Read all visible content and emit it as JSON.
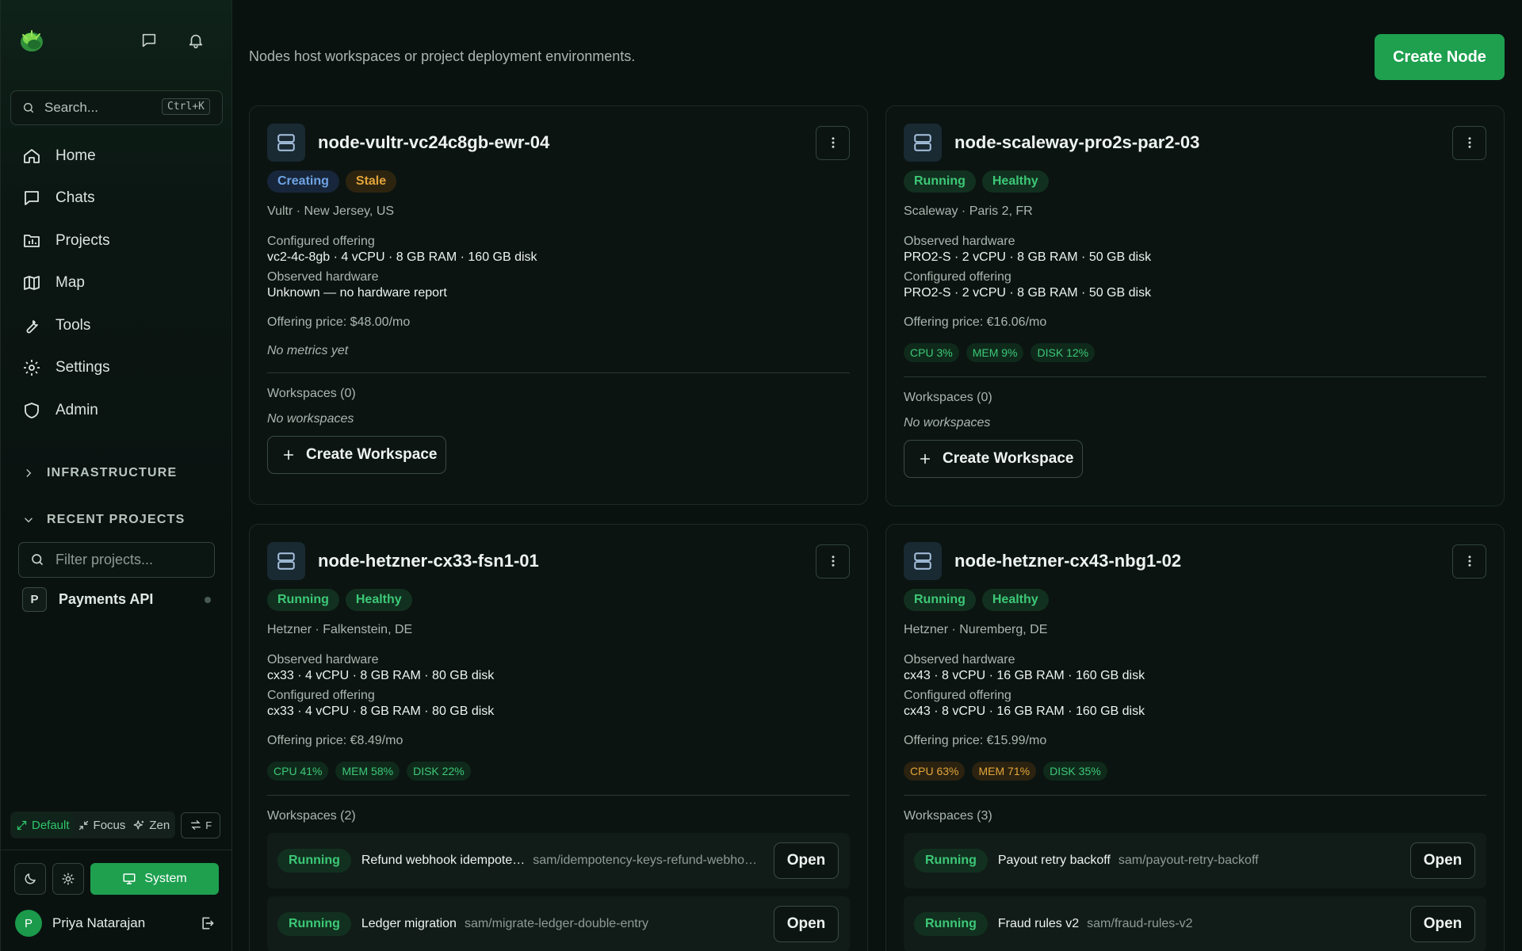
{
  "sidebar": {
    "search": {
      "label": "Search...",
      "shortcut": "Ctrl+K"
    },
    "nav": [
      {
        "label": "Home",
        "icon": "home-icon"
      },
      {
        "label": "Chats",
        "icon": "chat-icon"
      },
      {
        "label": "Projects",
        "icon": "projects-icon"
      },
      {
        "label": "Map",
        "icon": "map-icon"
      },
      {
        "label": "Tools",
        "icon": "wrench-icon"
      },
      {
        "label": "Settings",
        "icon": "gear-icon"
      },
      {
        "label": "Admin",
        "icon": "shield-icon"
      }
    ],
    "infrastructure_label": "INFRASTRUCTURE",
    "recent_projects_label": "RECENT PROJECTS",
    "filter_placeholder": "Filter projects...",
    "projects": [
      {
        "initial": "P",
        "name": "Payments API"
      }
    ],
    "modes": {
      "default": "Default",
      "focus": "Focus",
      "zen": "Zen",
      "swap_key": "F"
    },
    "theme": {
      "system_label": "System"
    },
    "user": {
      "initial": "P",
      "name": "Priya Natarajan"
    }
  },
  "header": {
    "subtitle": "Nodes host workspaces or project deployment environments.",
    "create_node_label": "Create Node"
  },
  "colors": {
    "accent": "#1ea04f",
    "running": "#3cc877",
    "warning": "#e3a53a",
    "creating": "#6fa3e4"
  },
  "nodes": [
    {
      "name": "node-vultr-vc24c8gb-ewr-04",
      "badges": [
        "Creating",
        "Stale"
      ],
      "provider": "Vultr",
      "location": "New Jersey, US",
      "first_label": "Configured offering",
      "first_value": "vc2-4c-8gb · 4 vCPU · 8 GB RAM · 160 GB disk",
      "second_label": "Observed hardware",
      "second_value": "Unknown — no hardware report",
      "price": "Offering price: $48.00/mo",
      "no_metrics": "No metrics yet",
      "workspaces_header": "Workspaces (0)",
      "no_workspaces": "No workspaces",
      "create_workspace_label": "Create Workspace"
    },
    {
      "name": "node-scaleway-pro2s-par2-03",
      "badges": [
        "Running",
        "Healthy"
      ],
      "provider": "Scaleway",
      "location": "Paris 2, FR",
      "first_label": "Observed hardware",
      "first_value": "PRO2-S · 2 vCPU · 8 GB RAM · 50 GB disk",
      "second_label": "Configured offering",
      "second_value": "PRO2-S · 2 vCPU · 8 GB RAM · 50 GB disk",
      "price": "Offering price: €16.06/mo",
      "metrics": [
        {
          "label": "CPU",
          "value": "3%"
        },
        {
          "label": "MEM",
          "value": "9%"
        },
        {
          "label": "DISK",
          "value": "12%"
        }
      ],
      "workspaces_header": "Workspaces (0)",
      "no_workspaces": "No workspaces",
      "create_workspace_label": "Create Workspace"
    },
    {
      "name": "node-hetzner-cx33-fsn1-01",
      "badges": [
        "Running",
        "Healthy"
      ],
      "provider": "Hetzner",
      "location": "Falkenstein, DE",
      "first_label": "Observed hardware",
      "first_value": "cx33 · 4 vCPU · 8 GB RAM · 80 GB disk",
      "second_label": "Configured offering",
      "second_value": "cx33 · 4 vCPU · 8 GB RAM · 80 GB disk",
      "price": "Offering price: €8.49/mo",
      "metrics": [
        {
          "label": "CPU",
          "value": "41%"
        },
        {
          "label": "MEM",
          "value": "58%"
        },
        {
          "label": "DISK",
          "value": "22%"
        }
      ],
      "workspaces_header": "Workspaces (2)",
      "workspaces": [
        {
          "status": "Running",
          "name": "Refund webhook idempote…",
          "branch": "sam/idempotency-keys-refund-webho…",
          "action": "Open"
        },
        {
          "status": "Running",
          "name": "Ledger migration",
          "branch": "sam/migrate-ledger-double-entry",
          "action": "Open"
        }
      ]
    },
    {
      "name": "node-hetzner-cx43-nbg1-02",
      "badges": [
        "Running",
        "Healthy"
      ],
      "provider": "Hetzner",
      "location": "Nuremberg, DE",
      "first_label": "Observed hardware",
      "first_value": "cx43 · 8 vCPU · 16 GB RAM · 160 GB disk",
      "second_label": "Configured offering",
      "second_value": "cx43 · 8 vCPU · 16 GB RAM · 160 GB disk",
      "price": "Offering price: €15.99/mo",
      "metrics": [
        {
          "label": "CPU",
          "value": "63%"
        },
        {
          "label": "MEM",
          "value": "71%"
        },
        {
          "label": "DISK",
          "value": "35%"
        }
      ],
      "workspaces_header": "Workspaces (3)",
      "workspaces": [
        {
          "status": "Running",
          "name": "Payout retry backoff",
          "branch": "sam/payout-retry-backoff",
          "action": "Open"
        },
        {
          "status": "Running",
          "name": "Fraud rules v2",
          "branch": "sam/fraud-rules-v2",
          "action": "Open"
        }
      ]
    }
  ]
}
